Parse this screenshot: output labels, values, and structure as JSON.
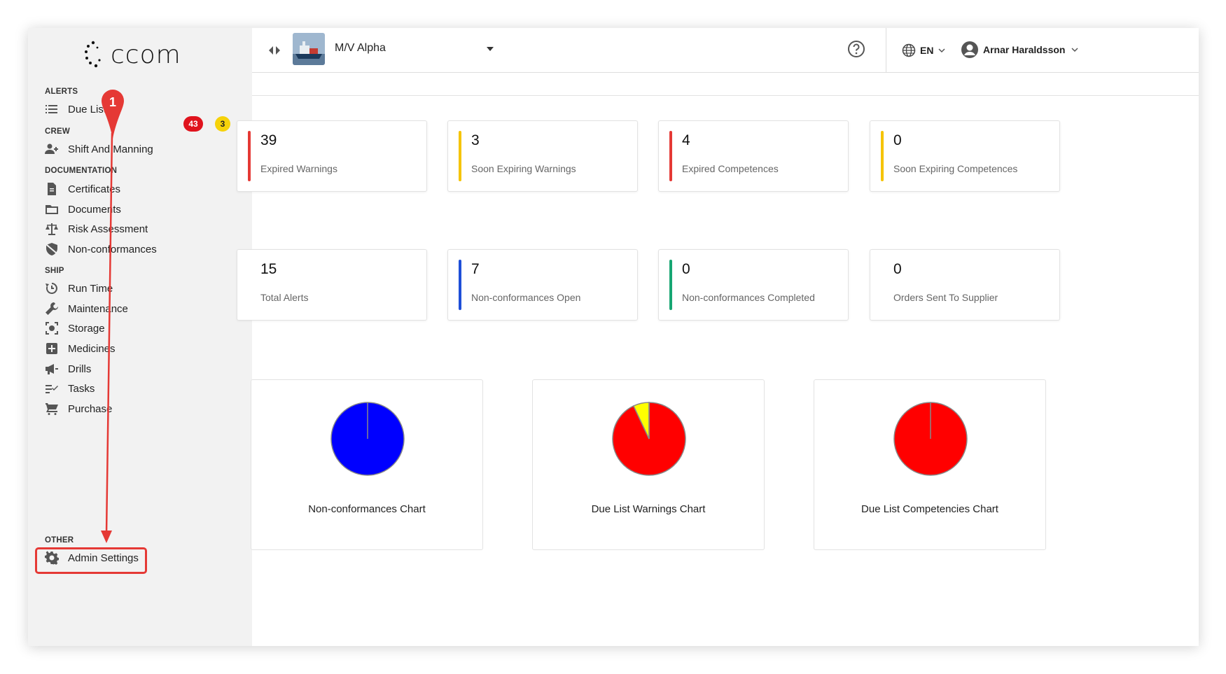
{
  "logo": {
    "text": "ccom"
  },
  "sidebar": {
    "sections": {
      "alerts": "ALERTS",
      "crew": "CREW",
      "documentation": "DOCUMENTATION",
      "ship": "SHIP",
      "other": "OTHER"
    },
    "items": {
      "due_list": "Due List",
      "shift": "Shift And Manning",
      "certificates": "Certificates",
      "documents": "Documents",
      "risk": "Risk Assessment",
      "nonconf": "Non-conformances",
      "runtime": "Run Time",
      "maintenance": "Maintenance",
      "storage": "Storage",
      "medicines": "Medicines",
      "drills": "Drills",
      "tasks": "Tasks",
      "purchase": "Purchase",
      "admin": "Admin Settings"
    },
    "badges": {
      "due_red": "43",
      "due_yellow": "3"
    }
  },
  "topbar": {
    "ship": "M/V Alpha",
    "lang": "EN",
    "user": "Arnar Haraldsson"
  },
  "cards": [
    {
      "num": "39",
      "label": "Expired Warnings",
      "color": "#e53935"
    },
    {
      "num": "3",
      "label": "Soon Expiring Warnings",
      "color": "#f5c400"
    },
    {
      "num": "4",
      "label": "Expired Competences",
      "color": "#e53935"
    },
    {
      "num": "0",
      "label": "Soon Expiring Competences",
      "color": "#f5c400"
    },
    {
      "num": "15",
      "label": "Total Alerts",
      "color": ""
    },
    {
      "num": "7",
      "label": "Non-conformances Open",
      "color": "#1e4fd8"
    },
    {
      "num": "0",
      "label": "Non-conformances Completed",
      "color": "#17a673"
    },
    {
      "num": "0",
      "label": "Orders Sent To Supplier",
      "color": ""
    }
  ],
  "annotation": {
    "step": "1"
  },
  "chart_data": [
    {
      "type": "pie",
      "title": "Non-conformances Chart",
      "values": [
        100
      ],
      "colors": [
        "#0000ff"
      ]
    },
    {
      "type": "pie",
      "title": "Due List Warnings Chart",
      "values": [
        93,
        7
      ],
      "colors": [
        "#ff0000",
        "#ffff00"
      ]
    },
    {
      "type": "pie",
      "title": "Due List Competencies Chart",
      "values": [
        100
      ],
      "colors": [
        "#ff0000"
      ]
    }
  ]
}
